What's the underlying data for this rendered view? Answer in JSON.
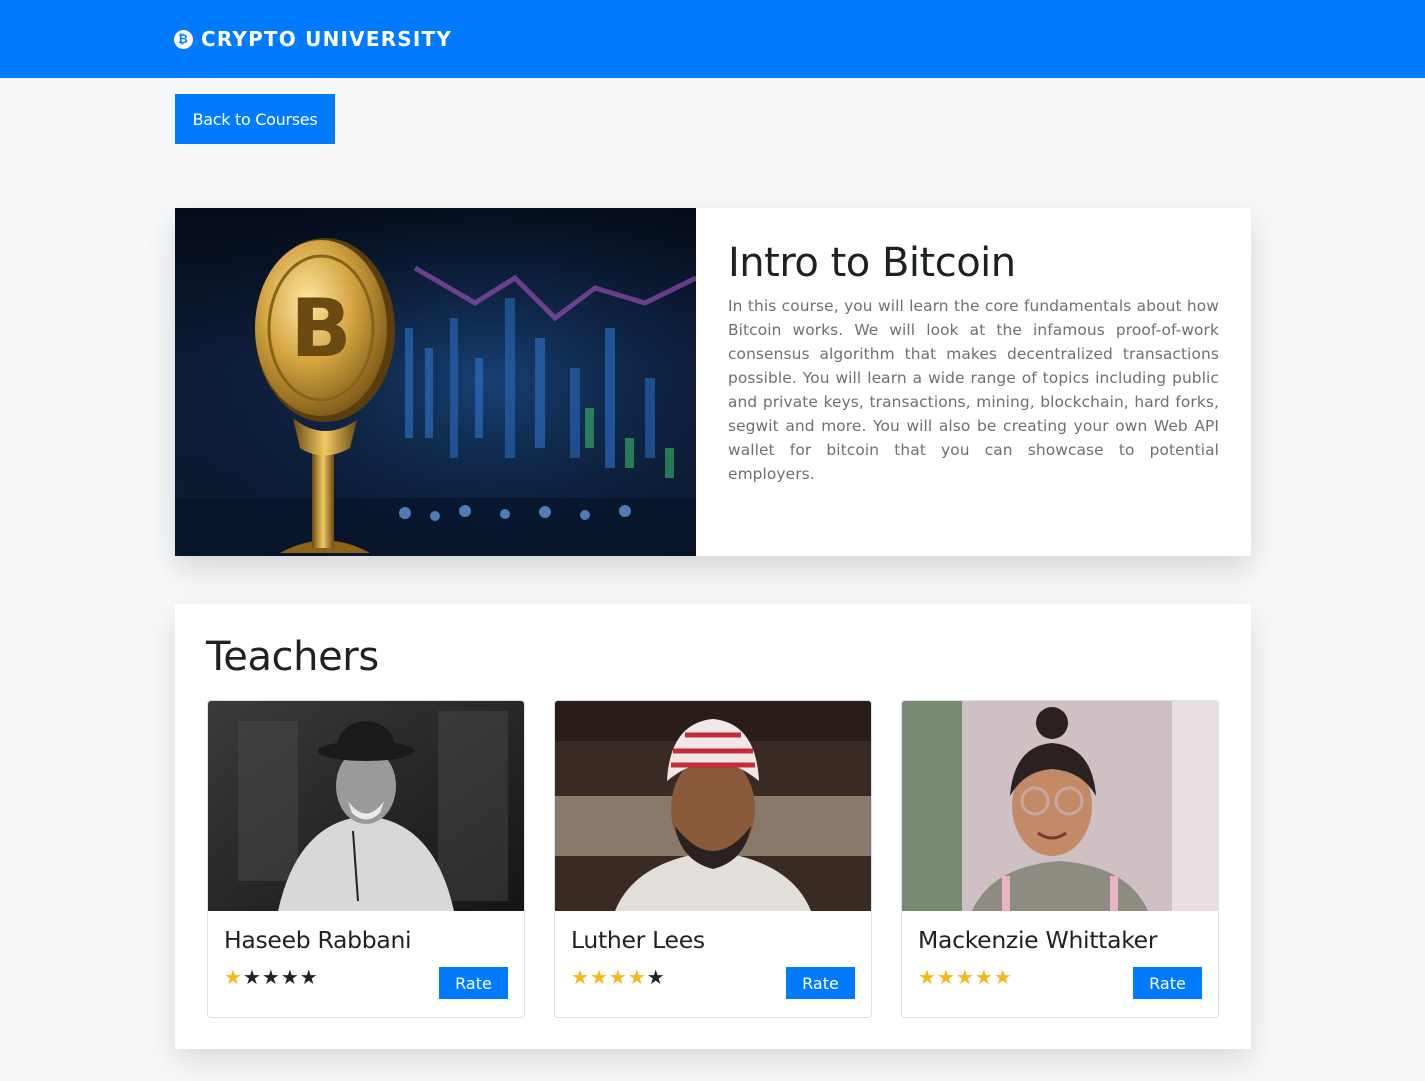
{
  "navbar": {
    "brand": "CRYPTO UNIVERSITY",
    "brand_icon": "bitcoin-coin-icon"
  },
  "back_button": "Back to Courses",
  "course": {
    "title": "Intro to Bitcoin",
    "description": "In this course, you will learn the core fundamentals about how Bitcoin works. We will look at the infamous proof-of-work consensus algorithm that makes decentralized transactions possible. You will learn a wide range of topics including public and private keys, transactions, mining, blockchain, hard forks, segwit and more. You will also be creating your own Web API wallet for bitcoin that you can showcase to potential employers.",
    "image": "bitcoin-coin-photo"
  },
  "teachers": {
    "heading": "Teachers",
    "list": [
      {
        "name": "Haseeb Rabbani",
        "rating": 1,
        "max_rating": 5,
        "rate_label": "Rate"
      },
      {
        "name": "Luther Lees",
        "rating": 4,
        "max_rating": 5,
        "rate_label": "Rate"
      },
      {
        "name": "Mackenzie Whittaker",
        "rating": 5,
        "max_rating": 5,
        "rate_label": "Rate"
      }
    ]
  },
  "colors": {
    "primary": "#007bff",
    "star_filled": "#f5b817",
    "star_empty": "#1f2326"
  }
}
